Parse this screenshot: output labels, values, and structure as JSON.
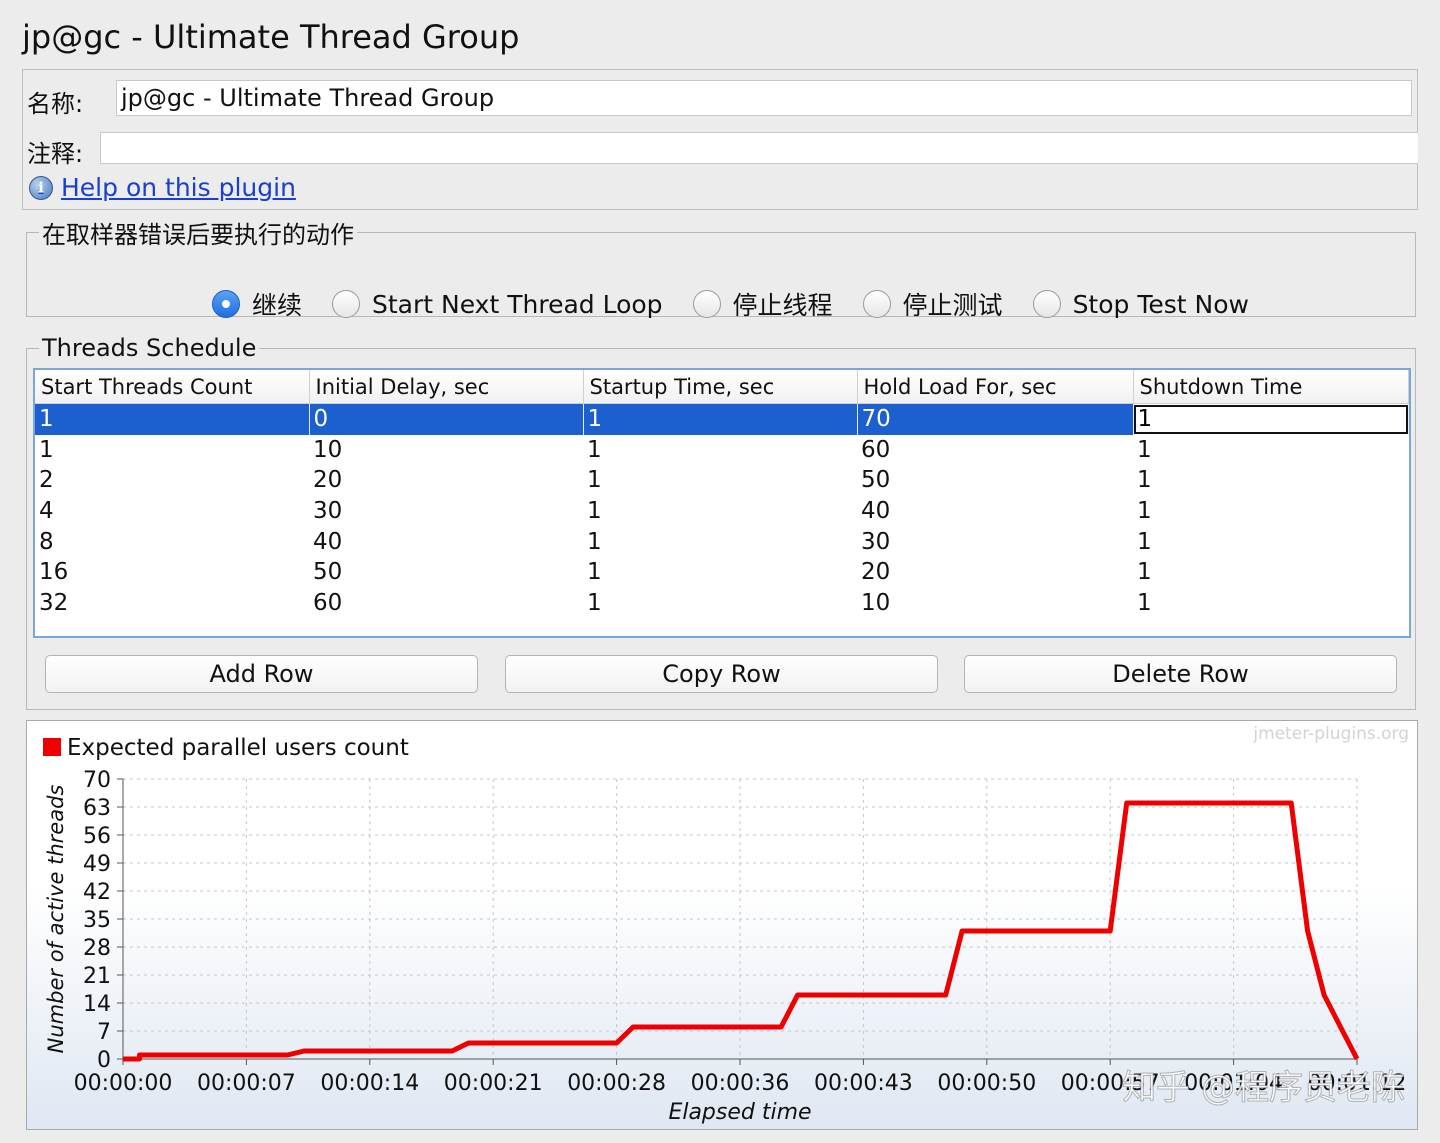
{
  "window": {
    "title": "jp@gc - Ultimate Thread Group"
  },
  "info": {
    "name_label": "名称:",
    "name_value": "jp@gc - Ultimate Thread Group",
    "comment_label": "注释:",
    "comment_value": "",
    "help_link": "Help on this plugin"
  },
  "error_action": {
    "legend": "在取样器错误后要执行的动作",
    "options": [
      {
        "label": "继续",
        "selected": true
      },
      {
        "label": "Start Next Thread Loop",
        "selected": false
      },
      {
        "label": "停止线程",
        "selected": false
      },
      {
        "label": "停止测试",
        "selected": false
      },
      {
        "label": "Stop Test Now",
        "selected": false
      }
    ]
  },
  "schedule": {
    "legend": "Threads Schedule",
    "columns": [
      "Start Threads Count",
      "Initial Delay, sec",
      "Startup Time, sec",
      "Hold Load For, sec",
      "Shutdown Time"
    ],
    "rows": [
      [
        "1",
        "0",
        "1",
        "70",
        "1"
      ],
      [
        "1",
        "10",
        "1",
        "60",
        "1"
      ],
      [
        "2",
        "20",
        "1",
        "50",
        "1"
      ],
      [
        "4",
        "30",
        "1",
        "40",
        "1"
      ],
      [
        "8",
        "40",
        "1",
        "30",
        "1"
      ],
      [
        "16",
        "50",
        "1",
        "20",
        "1"
      ],
      [
        "32",
        "60",
        "1",
        "10",
        "1"
      ]
    ],
    "selected_row": 0
  },
  "buttons": {
    "add": "Add Row",
    "copy": "Copy Row",
    "delete": "Delete Row"
  },
  "chart_data": {
    "type": "line",
    "watermark": "jmeter-plugins.org",
    "legend": "Expected parallel users count",
    "ylabel": "Number of active threads",
    "xlabel": "Elapsed time",
    "ylim": [
      0,
      70
    ],
    "xlim_seconds": [
      0,
      75
    ],
    "y_ticks": [
      "0",
      "7",
      "14",
      "21",
      "28",
      "35",
      "42",
      "49",
      "56",
      "63",
      "70"
    ],
    "x_ticks": [
      "00:00:00",
      "00:00:07",
      "00:00:14",
      "00:00:21",
      "00:00:28",
      "00:00:36",
      "00:00:43",
      "00:00:50",
      "00:00:57",
      "00:01:04",
      "00:01:12"
    ],
    "series_color": "#ee0000",
    "series": [
      {
        "name": "Expected parallel users count",
        "points_seconds": [
          [
            0,
            0
          ],
          [
            1,
            0
          ],
          [
            1,
            1
          ],
          [
            10,
            1
          ],
          [
            11,
            2
          ],
          [
            20,
            2
          ],
          [
            21,
            4
          ],
          [
            30,
            4
          ],
          [
            31,
            8
          ],
          [
            40,
            8
          ],
          [
            41,
            16
          ],
          [
            50,
            16
          ],
          [
            51,
            32
          ],
          [
            60,
            32
          ],
          [
            61,
            64
          ],
          [
            71,
            64
          ],
          [
            72,
            32
          ],
          [
            73,
            16
          ],
          [
            74,
            8
          ],
          [
            74.5,
            4
          ],
          [
            75,
            0
          ]
        ]
      }
    ],
    "grid": true,
    "legend_position": "top-left"
  },
  "overlay_watermark": "知乎 @程序员老陈"
}
